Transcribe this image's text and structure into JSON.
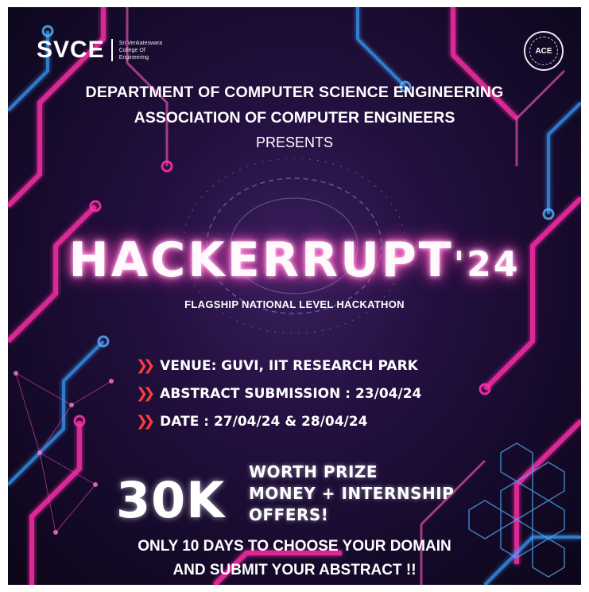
{
  "header": {
    "college_logo_text": "SVCE",
    "college_name": "Sri Venkateswara College Of Engineering",
    "assoc_logo_text": "ACE"
  },
  "intro": {
    "department": "DEPARTMENT OF COMPUTER SCIENCE ENGINEERING",
    "association": "ASSOCIATION OF COMPUTER ENGINEERS",
    "presents": "PRESENTS"
  },
  "event": {
    "title": "HACKERRUPT",
    "year": "'24",
    "tagline": "FLAGSHIP NATIONAL LEVEL HACKATHON"
  },
  "details": [
    {
      "text": "VENUE: GUVI, IIT RESEARCH PARK"
    },
    {
      "text": "ABSTRACT SUBMISSION : 23/04/24"
    },
    {
      "text": "DATE : 27/04/24 & 28/04/24"
    }
  ],
  "prize": {
    "amount": "30K",
    "line1": "WORTH PRIZE",
    "line2": "MONEY + INTERNSHIP",
    "line3": "OFFERS!"
  },
  "closing": {
    "line1": "ONLY 10 DAYS TO CHOOSE YOUR DOMAIN",
    "line2": "AND SUBMIT YOUR ABSTRACT !!"
  },
  "colors": {
    "neon_pink": "#ff2fa8",
    "neon_blue": "#3aa0ff",
    "chevron_red": "#ff3b3b",
    "background": "#1a0d33"
  }
}
